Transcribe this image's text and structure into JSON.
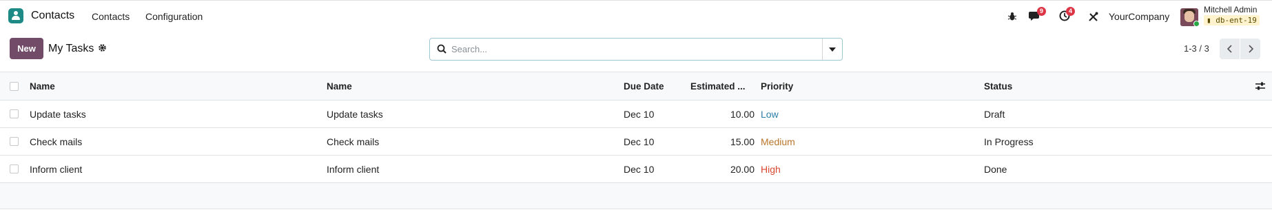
{
  "navbar": {
    "app_name": "Contacts",
    "menu": [
      "Contacts",
      "Configuration"
    ],
    "messages_count": "9",
    "activities_count": "4",
    "company": "YourCompany",
    "user_name": "Mitchell Admin",
    "database": "db-ent-19"
  },
  "control": {
    "new_label": "New",
    "title": "My Tasks",
    "search_placeholder": "Search...",
    "pager": "1-3 / 3"
  },
  "table": {
    "headers": [
      "Name",
      "Name",
      "Due Date",
      "Estimated ...",
      "Priority",
      "Status"
    ],
    "rows": [
      {
        "name": "Update tasks",
        "name2": "Update tasks",
        "due": "Dec 10",
        "estimated": "10.00",
        "priority": "Low",
        "status": "Draft"
      },
      {
        "name": "Check mails",
        "name2": "Check mails",
        "due": "Dec 10",
        "estimated": "15.00",
        "priority": "Medium",
        "status": "In Progress"
      },
      {
        "name": "Inform client",
        "name2": "Inform client",
        "due": "Dec 10",
        "estimated": "20.00",
        "priority": "High",
        "status": "Done"
      }
    ]
  },
  "colors": {
    "brand": "#714b67",
    "priority_low": "#2a7fa8",
    "priority_medium": "#b8762a",
    "priority_high": "#d9462f",
    "badge": "#dc3545"
  },
  "icons": [
    "contacts-app-icon",
    "bug-icon",
    "chat-icon",
    "clock-icon",
    "tools-icon",
    "gear-icon",
    "search-icon",
    "caret-down-icon",
    "chevron-left-icon",
    "chevron-right-icon",
    "column-settings-icon"
  ]
}
